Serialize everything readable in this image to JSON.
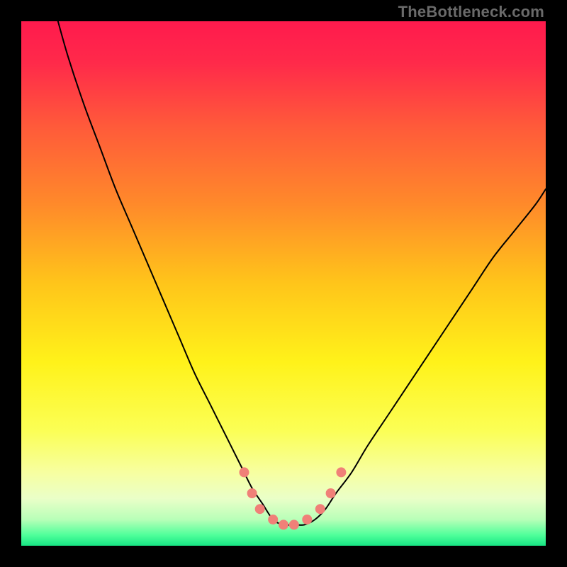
{
  "watermark": "TheBottleneck.com",
  "gradient": {
    "stops": [
      {
        "offset": 0.0,
        "color": "#ff1a4d"
      },
      {
        "offset": 0.08,
        "color": "#ff2a4a"
      },
      {
        "offset": 0.2,
        "color": "#ff5a3a"
      },
      {
        "offset": 0.35,
        "color": "#ff8a2a"
      },
      {
        "offset": 0.5,
        "color": "#ffc51a"
      },
      {
        "offset": 0.65,
        "color": "#fff21a"
      },
      {
        "offset": 0.78,
        "color": "#fbff55"
      },
      {
        "offset": 0.86,
        "color": "#f7ffa0"
      },
      {
        "offset": 0.91,
        "color": "#eaffc8"
      },
      {
        "offset": 0.95,
        "color": "#b8ffb8"
      },
      {
        "offset": 0.98,
        "color": "#4eff9a"
      },
      {
        "offset": 1.0,
        "color": "#17e584"
      }
    ]
  },
  "chart_data": {
    "type": "line",
    "title": "",
    "xlabel": "",
    "ylabel": "",
    "xlim": [
      0,
      100
    ],
    "ylim": [
      0,
      100
    ],
    "series": [
      {
        "name": "curve",
        "stroke": "#000000",
        "stroke_width": 2,
        "x": [
          7,
          9,
          12,
          15,
          18,
          21,
          24,
          27,
          30,
          33,
          36,
          39,
          42,
          44,
          46,
          48,
          50,
          52,
          54,
          56,
          58,
          60,
          63,
          66,
          70,
          74,
          78,
          82,
          86,
          90,
          94,
          98,
          100
        ],
        "values": [
          100,
          93,
          84,
          76,
          68,
          61,
          54,
          47,
          40,
          33,
          27,
          21,
          15,
          11,
          8,
          5,
          4,
          4,
          4,
          5,
          7,
          10,
          14,
          19,
          25,
          31,
          37,
          43,
          49,
          55,
          60,
          65,
          68
        ]
      }
    ],
    "markers": {
      "name": "dots",
      "color": "#f08078",
      "radius": 7,
      "points": [
        {
          "x": 42.5,
          "y": 14
        },
        {
          "x": 44.0,
          "y": 10
        },
        {
          "x": 45.5,
          "y": 7
        },
        {
          "x": 48.0,
          "y": 5
        },
        {
          "x": 50.0,
          "y": 4
        },
        {
          "x": 52.0,
          "y": 4
        },
        {
          "x": 54.5,
          "y": 5
        },
        {
          "x": 57.0,
          "y": 7
        },
        {
          "x": 59.0,
          "y": 10
        },
        {
          "x": 61.0,
          "y": 14
        }
      ]
    }
  }
}
